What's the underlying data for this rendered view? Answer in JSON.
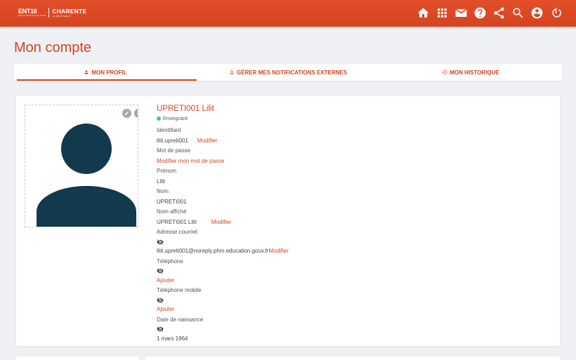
{
  "header": {
    "logo": {
      "ent": "ENT16",
      "ent_sub": "Espace Numérique de Travail",
      "region": "CHARENTE",
      "region_sub": "LE DÉPARTEMENT"
    },
    "icons": [
      "home-icon",
      "apps-grid-icon",
      "mail-icon",
      "help-icon",
      "share-icon",
      "search-icon",
      "account-icon",
      "power-icon"
    ],
    "color": "#d4431f"
  },
  "page": {
    "title": "Mon compte"
  },
  "tabs": [
    {
      "label": "MON PROFIL",
      "icon": "person-icon",
      "active": true
    },
    {
      "label": "GÉRER MES NOTIFICATIONS EXTERNES",
      "icon": "bell-icon",
      "active": false
    },
    {
      "label": "MON HISTORIQUE",
      "icon": "history-icon",
      "active": false
    }
  ],
  "profile": {
    "name": "UPRETI001 Lilit",
    "role": "Enseignant",
    "role_color": "#46bfaf",
    "login_label": "Identifiant",
    "login_value": "lilit.upreti001",
    "login_action": "Modifier",
    "password_label": "Mot de passe",
    "password_action": "Modifier mon mot de passe",
    "firstname_label": "Prénom",
    "firstname_value": "Lilit",
    "lastname_label": "Nom",
    "lastname_value": "UPRETI001",
    "display_label": "Nom affiché",
    "display_value": "UPRETI001 Lilit",
    "display_action": "Modifier",
    "email_label": "Adresse courriel",
    "email_value": "lilit.upreti001@noreply.phm.education.gouv.fr",
    "email_action": "Modifier",
    "phone_label": "Téléphone",
    "phone_action": "Ajouter",
    "mobile_label": "Téléphone mobile",
    "mobile_action": "Ajouter",
    "birth_label": "Date de naissance",
    "birth_value": "1 mars 1964"
  }
}
